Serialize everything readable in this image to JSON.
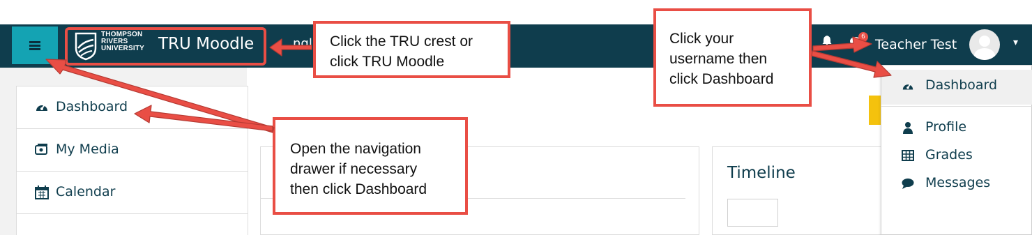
{
  "navbar": {
    "menu_icon": "hamburger-icon",
    "crest_lines": [
      "THOMPSON",
      "RIVERS",
      "UNIVERSITY"
    ],
    "site_name": "TRU Moodle",
    "language_partial": "ngli",
    "notifications_icon": "bell-icon",
    "messages_badge": "6",
    "username": "Teacher Test",
    "avatar_icon": "user-avatar-icon",
    "user_menu_caret": "▾"
  },
  "drawer": {
    "items": [
      {
        "label": "Dashboard",
        "icon": "tachometer-icon"
      },
      {
        "label": "My Media",
        "icon": "media-icon"
      },
      {
        "label": "Calendar",
        "icon": "calendar-icon"
      }
    ]
  },
  "main": {
    "timeline_title": "Timeline"
  },
  "user_menu": {
    "items": [
      {
        "label": "Dashboard",
        "icon": "tachometer-icon"
      },
      {
        "label": "Profile",
        "icon": "user-icon"
      },
      {
        "label": "Grades",
        "icon": "table-icon"
      },
      {
        "label": "Messages",
        "icon": "chat-icon"
      }
    ]
  },
  "callouts": {
    "crest": [
      "Click the TRU crest or",
      "click TRU Moodle"
    ],
    "username": [
      "Click your",
      "username then",
      "click Dashboard"
    ],
    "drawer": [
      "Open the navigation",
      "drawer if necessary",
      "then click Dashboard"
    ]
  },
  "colors": {
    "navbar": "#0f3d4d",
    "accent": "#14a3b3",
    "annotation": "#e94e45",
    "text_primary": "#0f3d4d"
  }
}
